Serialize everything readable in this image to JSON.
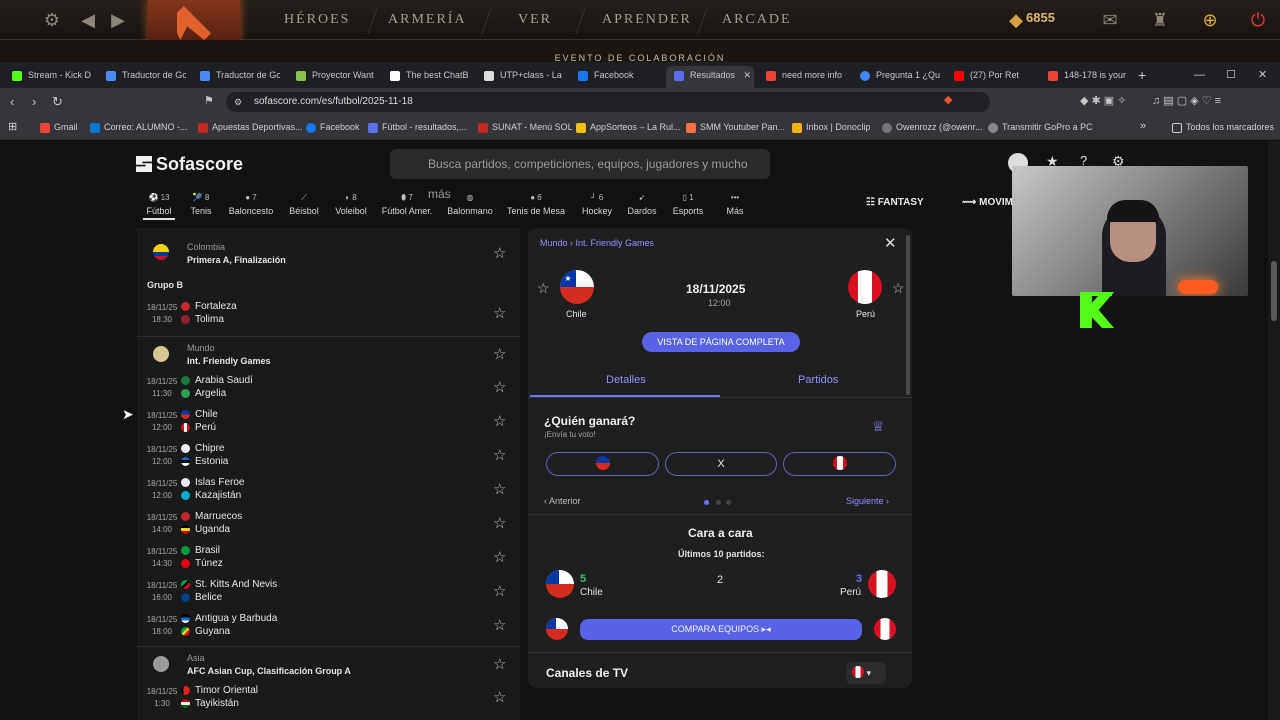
{
  "game_bar": {
    "nav": [
      "HÉROES",
      "ARMERÍA",
      "VER",
      "APRENDER",
      "ARCADE"
    ],
    "coins": "6855",
    "event": "EVENTO DE COLABORACIÓN"
  },
  "browser": {
    "tabs": [
      {
        "label": "Stream - Kick D",
        "color": "#53fc18"
      },
      {
        "label": "Traductor de Go",
        "color": "#4a8af4"
      },
      {
        "label": "Traductor de Go",
        "color": "#4a8af4"
      },
      {
        "label": "Proyector Want",
        "color": "#8bc34a"
      },
      {
        "label": "The best ChatB",
        "color": "#ffffff"
      },
      {
        "label": "UTP+class - La",
        "color": "#dddddd"
      },
      {
        "label": "Facebook",
        "color": "#1877f2"
      },
      {
        "label": "Resultados",
        "color": "#5a6cf0"
      },
      {
        "label": "need more info",
        "color": "#ea4335"
      },
      {
        "label": "Pregunta 1 ¿Qu",
        "color": "#4285f4"
      },
      {
        "label": "(27) Por Ret",
        "color": "#ff0000"
      },
      {
        "label": "148-178 is your",
        "color": "#ea4335"
      }
    ],
    "url": "sofascore.com/es/futbol/2025-11-18",
    "bookmarks": [
      "Gmail",
      "Correo: ALUMNO -...",
      "Apuestas Deportivas...",
      "Facebook",
      "Fútbol - resultados,...",
      "SUNAT - Menú SOL",
      "AppSorteos – La Rul...",
      "SMM Youtuber Pan...",
      "Inbox | Donoclip",
      "Owenrozz (@owenr...",
      "Transmitir GoPro a PC"
    ],
    "all_bookmarks": "Todos los marcadores"
  },
  "site": {
    "logo": "Sofascore",
    "search_placeholder": "Busca partidos, competiciones, equipos, jugadores y mucho más",
    "sports": [
      {
        "count": "13",
        "label": "Fútbol"
      },
      {
        "count": "8",
        "label": "Tenis"
      },
      {
        "count": "7",
        "label": "Baloncesto"
      },
      {
        "count": "",
        "label": "Béisbol"
      },
      {
        "count": "8",
        "label": "Voleibol"
      },
      {
        "count": "7",
        "label": "Fútbol Amer."
      },
      {
        "count": "",
        "label": "Balonmano"
      },
      {
        "count": "6",
        "label": "Tenis de Mesa"
      },
      {
        "count": "6",
        "label": "Hockey"
      },
      {
        "count": "",
        "label": "Dardos"
      },
      {
        "count": "1",
        "label": "Esports"
      },
      {
        "count": "",
        "label": "Más"
      }
    ],
    "fantasy": "FANTASY",
    "movil": "MOVIM"
  },
  "list": {
    "colombia": {
      "region": "Colombia",
      "league": "Primera A, Finalización",
      "group": "Grupo B",
      "match": {
        "date": "18/11/25",
        "time": "18:30",
        "home": "Fortaleza",
        "away": "Tolima"
      }
    },
    "friendly": {
      "region": "Mundo",
      "league": "Int. Friendly Games",
      "matches": [
        {
          "date": "18/11/25",
          "time": "11:30",
          "home": "Arabia Saudí",
          "away": "Argelia"
        },
        {
          "date": "18/11/25",
          "time": "12:00",
          "home": "Chile",
          "away": "Perú"
        },
        {
          "date": "18/11/25",
          "time": "12:00",
          "home": "Chipre",
          "away": "Estonia"
        },
        {
          "date": "18/11/25",
          "time": "12:00",
          "home": "Islas Feroe",
          "away": "Kazajistán"
        },
        {
          "date": "18/11/25",
          "time": "14:00",
          "home": "Marruecos",
          "away": "Uganda"
        },
        {
          "date": "18/11/25",
          "time": "14:30",
          "home": "Brasil",
          "away": "Túnez"
        },
        {
          "date": "18/11/25",
          "time": "16:00",
          "home": "St. Kitts And Nevis",
          "away": "Belice"
        },
        {
          "date": "18/11/25",
          "time": "18:00",
          "home": "Antigua y Barbuda",
          "away": "Guyana"
        }
      ]
    },
    "asia": {
      "region": "Asia",
      "league": "AFC Asian Cup, Clasificación Group A",
      "match": {
        "date": "18/11/25",
        "time": "1:30",
        "home": "Timor Oriental",
        "away": "Tayikistán"
      }
    }
  },
  "panel": {
    "breadcrumb": [
      "Mundo",
      "Int. Friendly Games"
    ],
    "date": "18/11/2025",
    "time": "12:00",
    "home": "Chile",
    "away": "Perú",
    "full_view": "VISTA DE PÁGINA COMPLETA",
    "tabs": [
      "Detalles",
      "Partidos"
    ],
    "who_wins": "¿Quién ganará?",
    "vote_sub": "¡Envía tu voto!",
    "draw": "X",
    "prev": "Anterior",
    "next": "Siguiente",
    "h2h_title": "Cara a cara",
    "h2h_sub": "Últimos 10 partidos:",
    "h2h": {
      "home_wins": "5",
      "draws": "2",
      "away_wins": "3"
    },
    "compare": "COMPARA EQUIPOS",
    "tv": "Canales de TV"
  }
}
